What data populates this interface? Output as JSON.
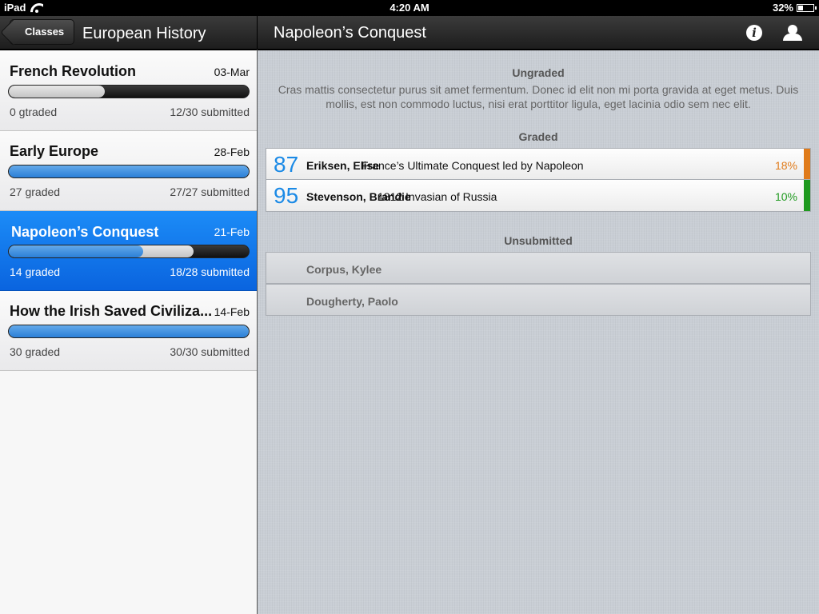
{
  "status": {
    "carrier": "iPad",
    "time": "4:20 AM",
    "battery": "32%",
    "battery_level": 0.32
  },
  "left_nav": {
    "back_label": "Classes",
    "title": "European History"
  },
  "right_nav": {
    "title": "Napoleon’s Conquest",
    "info_icon": "info-icon",
    "user_icon": "user-icon"
  },
  "classes": [
    {
      "name": "French Revolution",
      "date": "03-Mar",
      "graded_text": "0 gtraded",
      "submitted_text": "12/30 submitted",
      "graded_fraction": 0.0,
      "submitted_fraction": 0.4
    },
    {
      "name": "Early Europe",
      "date": "28-Feb",
      "graded_text": "27 graded",
      "submitted_text": "27/27 submitted",
      "graded_fraction": 1.0,
      "submitted_fraction": 1.0
    },
    {
      "name": "Napoleon’s Conquest",
      "date": "21-Feb",
      "graded_text": "14 graded",
      "submitted_text": "18/28 submitted",
      "graded_fraction": 0.56,
      "submitted_fraction": 0.77
    },
    {
      "name": "How the Irish Saved Civiliza...",
      "date": "14-Feb",
      "graded_text": "30 graded",
      "submitted_text": "30/30 submitted",
      "graded_fraction": 1.0,
      "submitted_fraction": 1.0
    }
  ],
  "selected_index": 2,
  "ungraded": {
    "title": "Ungraded",
    "description": "Cras mattis consectetur purus sit amet fermentum. Donec id elit non mi porta gravida at eget metus. Duis mollis, est non commodo luctus, nisi erat porttitor ligula, eget lacinia odio sem nec elit."
  },
  "graded": {
    "title": "Graded",
    "items": [
      {
        "score": "87",
        "student": "Eriksen, Elise",
        "assignment": "France’s Ultimate Conquest led by Napoleon",
        "percent": "18%",
        "color": "#e07b1a"
      },
      {
        "score": "95",
        "student": "Stevenson, Brandie",
        "assignment": "1812 Invasian of Russia",
        "percent": "10%",
        "color": "#1f9a1f"
      }
    ]
  },
  "unsubmitted": {
    "title": "Unsubmitted",
    "items": [
      "Corpus, Kylee",
      "Dougherty, Paolo"
    ]
  }
}
